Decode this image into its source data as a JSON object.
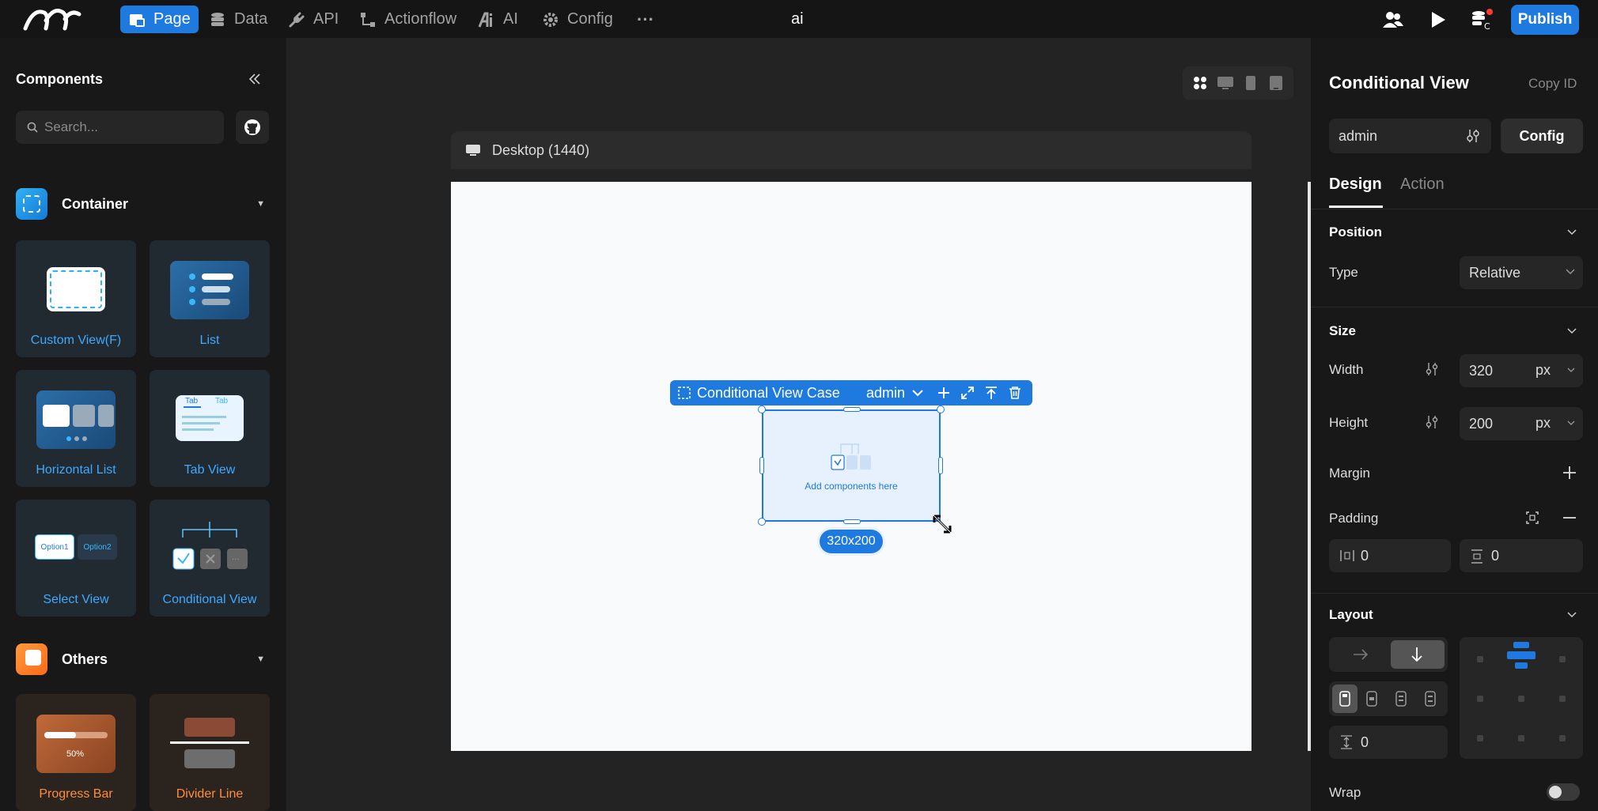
{
  "topbar": {
    "nav": [
      {
        "label": "Page",
        "icon": "page-icon"
      },
      {
        "label": "Data",
        "icon": "database-icon"
      },
      {
        "label": "API",
        "icon": "plug-icon"
      },
      {
        "label": "Actionflow",
        "icon": "flow-icon"
      },
      {
        "label": "AI",
        "icon": "ai-icon"
      },
      {
        "label": "Config",
        "icon": "gear-icon"
      }
    ],
    "more": "···",
    "title": "ai",
    "publish": "Publish",
    "accent": "#1f7ae0"
  },
  "left": {
    "title": "Components",
    "search_placeholder": "Search...",
    "container_section": "Container",
    "others_section": "Others",
    "container_items": [
      "Custom View(F)",
      "List",
      "Horizontal List",
      "Tab View",
      "Select View",
      "Conditional View"
    ],
    "others_items": [
      "Progress Bar",
      "Divider Line"
    ],
    "tab_thumb": [
      "Tab",
      "Tab"
    ],
    "select_thumb": [
      "Option1",
      "Option2"
    ],
    "progress_thumb": "50%",
    "progress_value": 0.5
  },
  "canvas": {
    "device_label": "Desktop (1440)",
    "selection_label": "Conditional View Case",
    "selection_case": "admin",
    "placeholder": "Add components here",
    "size_badge": "320x200"
  },
  "right": {
    "title": "Conditional View",
    "copy_id": "Copy ID",
    "case_value": "admin",
    "config": "Config",
    "tabs": [
      "Design",
      "Action"
    ],
    "position": {
      "header": "Position",
      "type_label": "Type",
      "type_value": "Relative"
    },
    "size": {
      "header": "Size",
      "width_label": "Width",
      "width": "320",
      "height_label": "Height",
      "height": "200",
      "unit": "px"
    },
    "margin_label": "Margin",
    "padding_label": "Padding",
    "padding_h": "0",
    "padding_v": "0",
    "layout": {
      "header": "Layout",
      "gap": "0"
    },
    "wrap_label": "Wrap"
  }
}
